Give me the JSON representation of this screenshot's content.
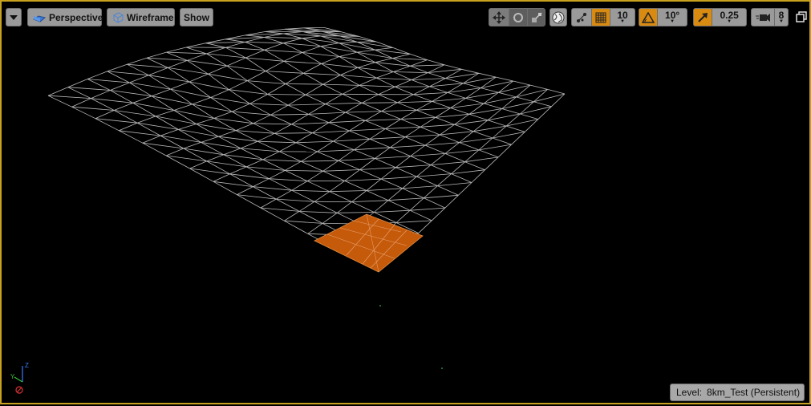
{
  "toolbar": {
    "options_menu": "options-dropdown",
    "perspective_label": "Perspective",
    "wireframe_label": "Wireframe",
    "show_label": "Show",
    "grid_snap_value": "10",
    "rotation_snap_value": "10°",
    "scale_snap_value": "0.25",
    "camera_speed_value": "8"
  },
  "status": {
    "level_label": "Level:",
    "level_name": "8km_Test (Persistent)"
  },
  "colors": {
    "viewport_border": "#c8a21e",
    "active_toggle": "#d98a10",
    "selection_fill": "#c55a0a",
    "wireframe": "#b8b8b8"
  },
  "icons": [
    "chevron-down-icon",
    "cube-icon",
    "wireframe-cube-icon",
    "translate-icon",
    "rotate-icon",
    "scale-icon",
    "globe-icon",
    "surface-snap-icon",
    "grid-icon",
    "angle-icon",
    "scale-arrow-icon",
    "camera-icon",
    "maximize-icon",
    "axis-gizmo-icon"
  ]
}
